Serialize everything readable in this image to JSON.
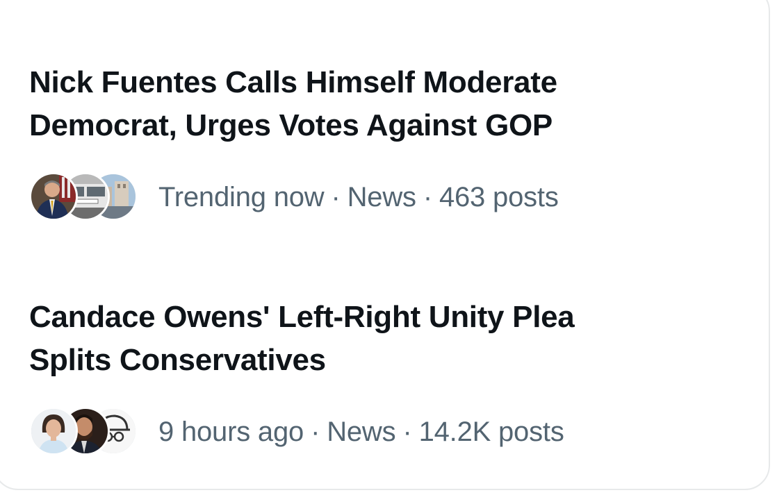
{
  "trends": [
    {
      "title_line1": "Nick Fuentes Calls Himself Moderate",
      "title_line2": "Democrat, Urges Votes Against GOP",
      "time": "Trending now",
      "category": "News",
      "posts": "463 posts",
      "separator": "·",
      "avatar_icons": [
        "man-in-suit-avatar-icon",
        "bus-photo-avatar-icon",
        "crowd-photo-avatar-icon"
      ]
    },
    {
      "title_line1": "Candace Owens' Left-Right Unity Plea",
      "title_line2": "Splits Conservatives",
      "time": "9 hours ago",
      "category": "News",
      "posts": "14.2K posts",
      "separator": "·",
      "avatar_icons": [
        "woman-portrait-avatar-icon",
        "bearded-man-avatar-icon",
        "cap-sketch-avatar-icon"
      ]
    }
  ],
  "colors": {
    "title": "#0f1419",
    "meta": "#536471",
    "border": "#e7e9ea"
  }
}
